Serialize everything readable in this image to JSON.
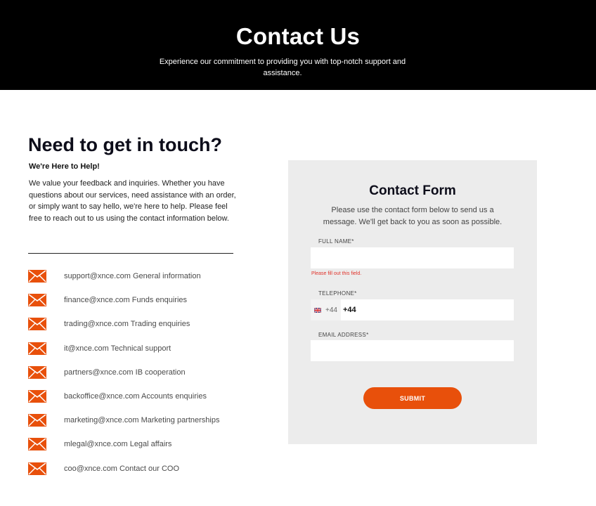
{
  "colors": {
    "accent": "#e8500b",
    "hero_bg": "#000000",
    "panel_bg": "#ececec",
    "error": "#e0322a"
  },
  "hero": {
    "title": "Contact Us",
    "subtitle": "Experience our commitment to providing you with top-notch support and assistance."
  },
  "left": {
    "title": "Need to get in touch?",
    "subtitle": "We're Here to Help!",
    "paragraph": "We value your feedback and inquiries. Whether you have questions about our services, need assistance with an order, or simply want to say hello, we're here to help. Please feel free to reach out to us using the contact information below.",
    "contacts": [
      {
        "icon": "mail-icon",
        "text": "support@xnce.com General information"
      },
      {
        "icon": "mail-icon",
        "text": "finance@xnce.com Funds enquiries"
      },
      {
        "icon": "mail-icon",
        "text": "trading@xnce.com Trading enquiries"
      },
      {
        "icon": "mail-icon",
        "text": "it@xnce.com Technical support"
      },
      {
        "icon": "mail-icon",
        "text": "partners@xnce.com IB cooperation"
      },
      {
        "icon": "mail-icon",
        "text": "backoffice@xnce.com Accounts enquiries"
      },
      {
        "icon": "mail-icon",
        "text": "marketing@xnce.com Marketing partnerships"
      },
      {
        "icon": "mail-icon",
        "text": "mlegal@xnce.com Legal affairs"
      },
      {
        "icon": "mail-icon",
        "text": "coo@xnce.com Contact our COO"
      }
    ]
  },
  "form": {
    "title": "Contact Form",
    "description": "Please use the contact form below to send us a message. We'll get back to you as soon as possible.",
    "full_name": {
      "label": "FULL NAME*",
      "value": "",
      "error": "Please fill out this field."
    },
    "telephone": {
      "label": "TELEPHONE*",
      "flag_icon": "uk-flag-icon",
      "dial_code": "+44",
      "value": "+44"
    },
    "email": {
      "label": "EMAIL ADDRESS*",
      "value": ""
    },
    "submit_label": "SUBMIT"
  }
}
